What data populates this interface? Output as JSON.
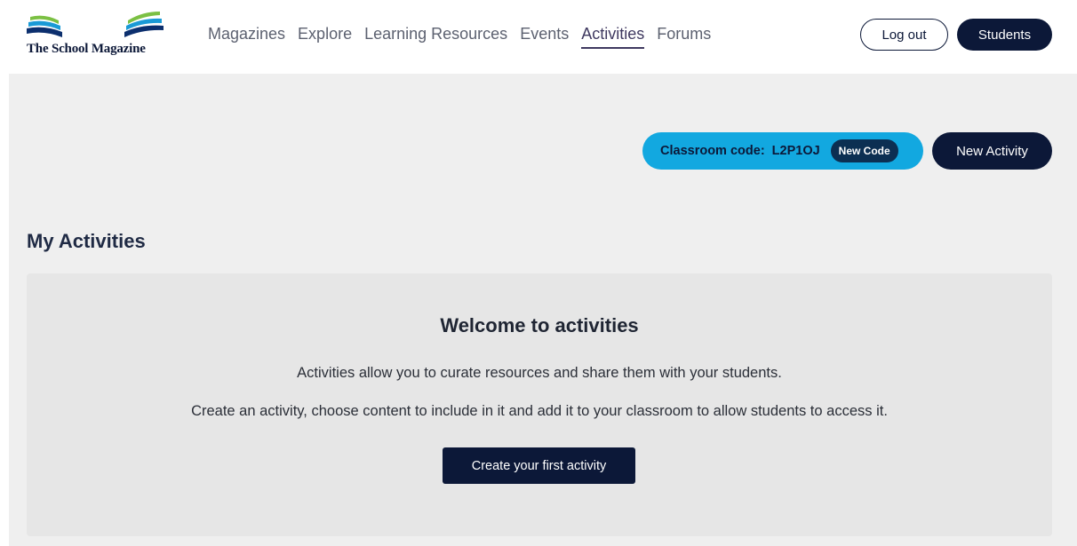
{
  "header": {
    "logo_text": "The School Magazine",
    "nav": [
      {
        "label": "Magazines",
        "active": false
      },
      {
        "label": "Explore",
        "active": false
      },
      {
        "label": "Learning Resources",
        "active": false
      },
      {
        "label": "Events",
        "active": false
      },
      {
        "label": "Activities",
        "active": true
      },
      {
        "label": "Forums",
        "active": false
      }
    ],
    "logout_label": "Log out",
    "students_label": "Students"
  },
  "toolbar": {
    "classroom_code_label": "Classroom code:",
    "classroom_code_value": "L2P1OJ",
    "new_code_label": "New Code",
    "new_activity_label": "New Activity"
  },
  "main": {
    "title": "My Activities",
    "welcome": {
      "title": "Welcome to activities",
      "line1": "Activities allow you to curate resources and share them with your students.",
      "line2": "Create an activity, choose content to include in it and add it to your classroom to allow students to access it.",
      "cta_label": "Create your first activity"
    }
  },
  "colors": {
    "navy": "#0c1838",
    "accent_blue": "#12a8e0",
    "logo_green": "#7bc043",
    "logo_blue": "#1a9ad6",
    "background": "#efefef"
  },
  "icons": [
    "book-logo-icon"
  ]
}
